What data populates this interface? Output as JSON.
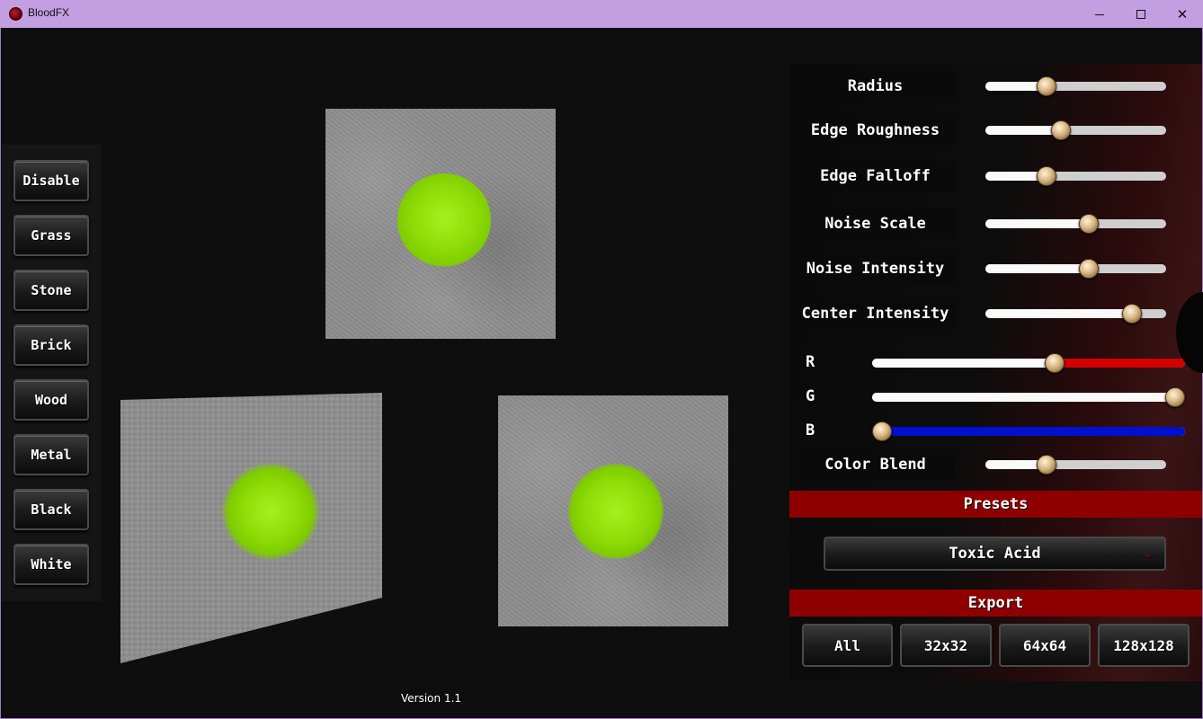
{
  "window": {
    "title": "BloodFX",
    "close_glyph": "✕"
  },
  "materials": [
    "Disable",
    "Grass",
    "Stone",
    "Brick",
    "Wood",
    "Metal",
    "Black",
    "White"
  ],
  "sliders": [
    {
      "label": "Radius",
      "value": 0.32
    },
    {
      "label": "Edge Roughness",
      "value": 0.41
    },
    {
      "label": "Edge Falloff",
      "value": 0.32
    },
    {
      "label": "Noise Scale",
      "value": 0.58
    },
    {
      "label": "Noise Intensity",
      "value": 0.58
    },
    {
      "label": "Center Intensity",
      "value": 0.85
    }
  ],
  "color": {
    "r": {
      "label": "R",
      "value": 0.59,
      "accent": "#d40000"
    },
    "g": {
      "label": "G",
      "value": 1.0,
      "accent": "#cfcfcf"
    },
    "b": {
      "label": "B",
      "value": 0.0,
      "accent": "#0010cc"
    }
  },
  "color_blend": {
    "label": "Color Blend",
    "value": 0.32
  },
  "presets": {
    "heading": "Presets",
    "selected": "Toxic Acid"
  },
  "export": {
    "heading": "Export",
    "buttons": [
      "All",
      "32x32",
      "64x64",
      "128x128"
    ]
  },
  "version": "Version 1.1",
  "colors": {
    "splat": "#8fdc08",
    "accent": "#8e0000",
    "titlebar": "#c39ee0"
  }
}
